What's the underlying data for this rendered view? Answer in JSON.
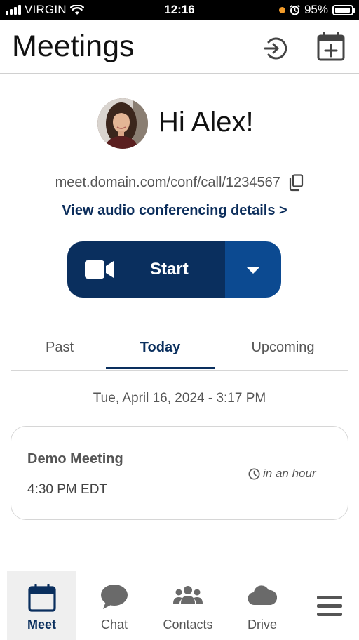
{
  "status_bar": {
    "carrier": "VIRGIN",
    "time": "12:16",
    "battery": "95%",
    "battery_level": 0.95
  },
  "header": {
    "title": "Meetings",
    "icons": [
      "join-meeting-icon",
      "schedule-meeting-icon"
    ]
  },
  "greeting": {
    "text": "Hi Alex!"
  },
  "meeting_link": {
    "url": "meet.domain.com/conf/call/1234567",
    "audio_details_label": "View audio conferencing details >"
  },
  "start_button": {
    "label": "Start",
    "icon": "video-camera-icon"
  },
  "tabs": [
    {
      "label": "Past",
      "active": false
    },
    {
      "label": "Today",
      "active": true
    },
    {
      "label": "Upcoming",
      "active": false
    }
  ],
  "date_line": "Tue, April 16, 2024 - 3:17 PM",
  "meetings": [
    {
      "title": "Demo Meeting",
      "time": "4:30 PM EDT",
      "relative": "in an hour"
    }
  ],
  "bottom_nav": [
    {
      "label": "Meet",
      "icon": "calendar-icon",
      "active": true
    },
    {
      "label": "Chat",
      "icon": "chat-bubble-icon",
      "active": false
    },
    {
      "label": "Contacts",
      "icon": "contacts-icon",
      "active": false
    },
    {
      "label": "Drive",
      "icon": "cloud-icon",
      "active": false
    },
    {
      "label": "",
      "icon": "menu-icon",
      "active": false
    }
  ],
  "colors": {
    "primary": "#0a2f5e",
    "dropdown": "#0c4a91",
    "text_muted": "#555555",
    "status_dot": "#f39c2a"
  }
}
